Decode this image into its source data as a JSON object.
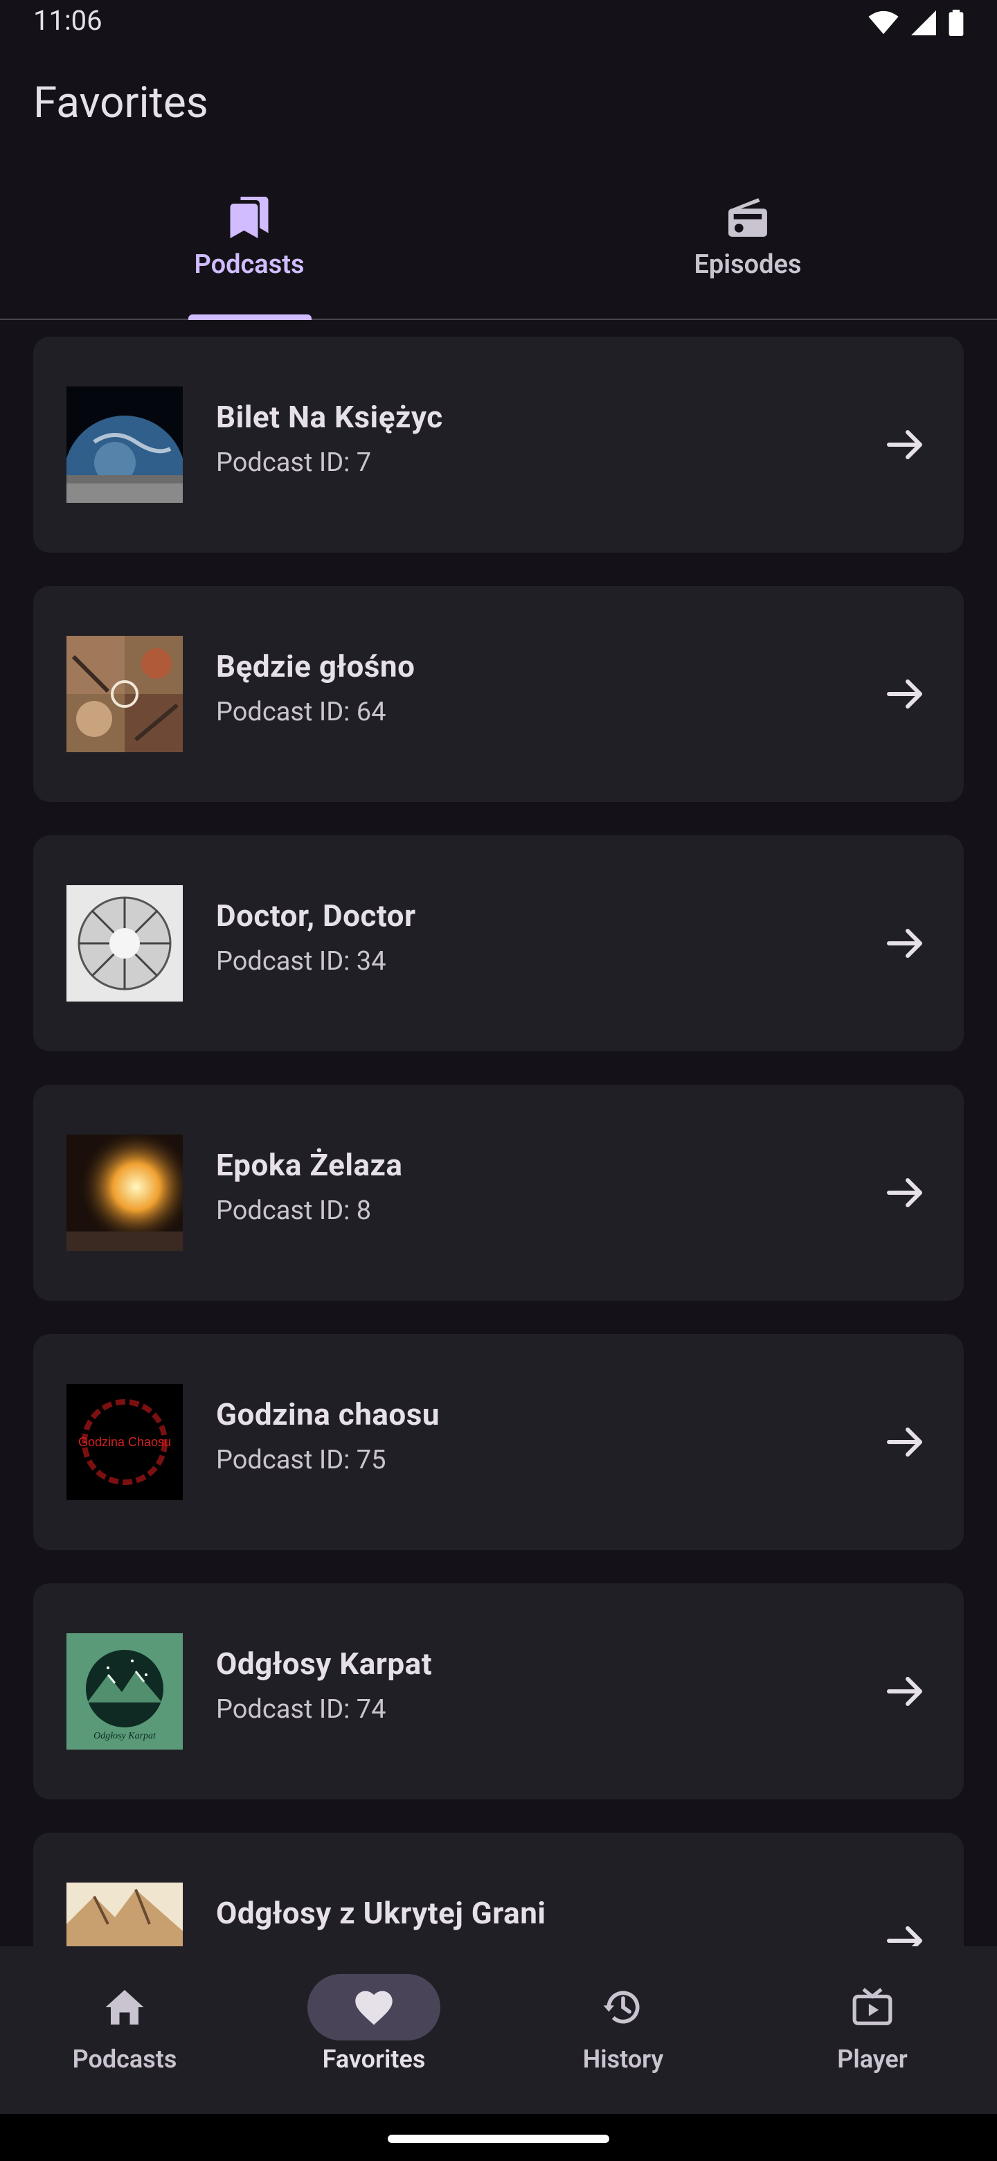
{
  "status_bar": {
    "time": "11:06"
  },
  "app_bar": {
    "title": "Favorites"
  },
  "tabs": [
    {
      "label": "Podcasts",
      "icon": "bookmarks-icon",
      "active": true
    },
    {
      "label": "Episodes",
      "icon": "radio-icon",
      "active": false
    }
  ],
  "podcasts": [
    {
      "title": "Bilet Na Księżyc",
      "subtitle": "Podcast ID: 7"
    },
    {
      "title": "Będzie głośno",
      "subtitle": "Podcast ID: 64"
    },
    {
      "title": "Doctor, Doctor",
      "subtitle": "Podcast ID: 34"
    },
    {
      "title": "Epoka Żelaza",
      "subtitle": "Podcast ID: 8"
    },
    {
      "title": "Godzina chaosu",
      "subtitle": "Podcast ID: 75",
      "cover_text": "Godzina Chaosu"
    },
    {
      "title": "Odgłosy Karpat",
      "subtitle": "Podcast ID: 74",
      "cover_text": "Odgłosy Karpat"
    },
    {
      "title": "Odgłosy z Ukrytej Grani",
      "subtitle": ""
    }
  ],
  "bottom_nav": [
    {
      "label": "Podcasts",
      "icon": "home-icon",
      "active": false
    },
    {
      "label": "Favorites",
      "icon": "heart-icon",
      "active": true
    },
    {
      "label": "History",
      "icon": "history-icon",
      "active": false
    },
    {
      "label": "Player",
      "icon": "tv-play-icon",
      "active": false
    }
  ],
  "colors": {
    "background": "#141218",
    "surface": "#211F26",
    "accent": "#D0BCFF",
    "on_surface": "#E6E0E9",
    "on_surface_variant": "#CAC4D0"
  }
}
